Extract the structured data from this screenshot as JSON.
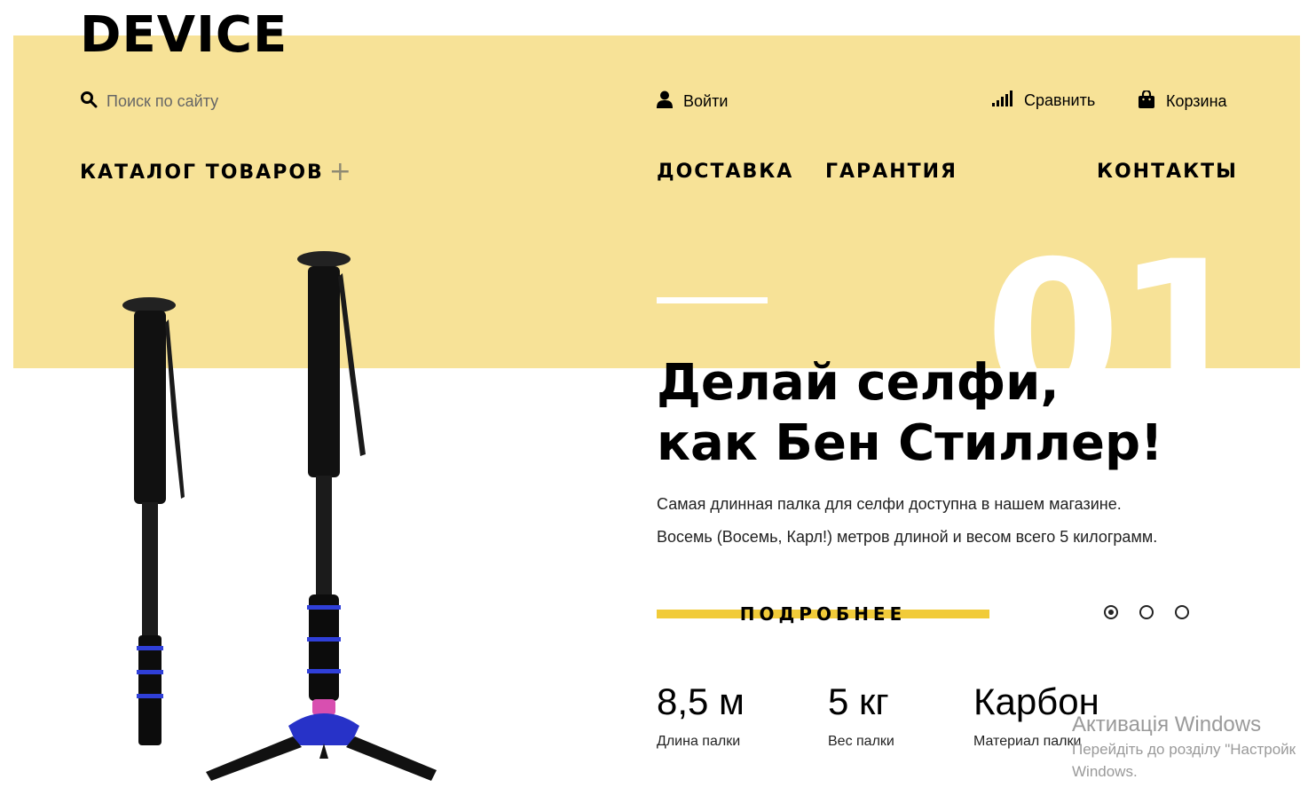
{
  "header": {
    "logo": "DEVICE",
    "search": {
      "placeholder": "Поиск по сайту"
    },
    "login_label": "Войти",
    "compare_label": "Сравнить",
    "cart_label": "Корзина"
  },
  "nav": {
    "catalog_label": "КАТАЛОГ ТОВАРОВ",
    "catalog_toggle": "+",
    "delivery_label": "ДОСТАВКА",
    "warranty_label": "ГАРАНТИЯ",
    "contacts_label": "КОНТАКТЫ"
  },
  "slider": {
    "slide_number": "01",
    "headline": [
      "Делай селфи,",
      "как Бен Стиллер!"
    ],
    "description": [
      "Самая длинная палка для селфи доступна в нашем магазине.",
      "Восемь (Восемь, Карл!) метров длиной и весом всего 5 килограмм."
    ],
    "more_button_label": "ПОДРОБНЕЕ",
    "dots_count": 3,
    "active_dot": 1
  },
  "stats": [
    {
      "value": "8,5 м",
      "label": "Длина палки"
    },
    {
      "value": "5 кг",
      "label": "Вес палки"
    },
    {
      "value": "Карбон",
      "label": "Материал палки"
    }
  ],
  "watermark": {
    "line1": "Активація Windows",
    "line2": "Перейдіть до розділу \"Настройк",
    "line3": "Windows."
  },
  "colors": {
    "header_background": "#f7e297",
    "accent": "#f1cb39",
    "text": "#000000",
    "number_overlay": "#ffffff"
  },
  "icons": [
    "search-icon",
    "user-icon",
    "signal-bars-icon",
    "shopping-bag-icon"
  ]
}
